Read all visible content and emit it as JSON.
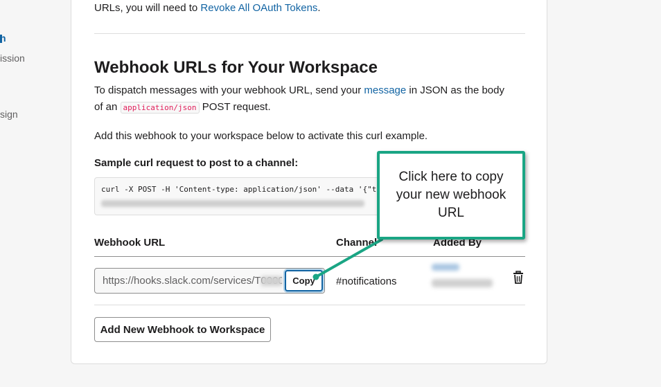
{
  "sidebar": {
    "items": [
      {
        "label": "n",
        "style": "accent"
      },
      {
        "label": "ission"
      },
      {
        "label": "sign"
      }
    ]
  },
  "intro": {
    "text": "URLs, you will need to",
    "link": "Revoke All OAuth Tokens",
    "end": "."
  },
  "section": {
    "title": "Webhook URLs for Your Workspace",
    "para1_a": "To dispatch messages with your webhook URL, send your",
    "para1_link": "message",
    "para1_b": "in JSON as the body",
    "para1_c": "of an",
    "para1_code": "application/json",
    "para1_d": "POST request.",
    "para2": "Add this webhook to your workspace below to activate this curl example.",
    "sample_heading": "Sample curl request to post to a channel:",
    "curl_line1": "curl -X POST -H 'Content-type: application/json' --data '{\"text\":\"Hello, World!\"}'"
  },
  "table": {
    "headers": {
      "webhook_url": "Webhook URL",
      "channel": "Channel",
      "added_by": "Added By"
    },
    "rows": [
      {
        "url_value": "https://hooks.slack.com/services/T0000000/B000",
        "copy_label": "Copy",
        "channel": "#notifications"
      }
    ]
  },
  "add_button_label": "Add New Webhook to Workspace",
  "callout": {
    "text": "Click here to copy your new webhook URL"
  },
  "colors": {
    "link": "#1264a3",
    "callout_border": "#1aa584",
    "code": "#e01e5a"
  },
  "icons": [
    "trash-icon"
  ]
}
